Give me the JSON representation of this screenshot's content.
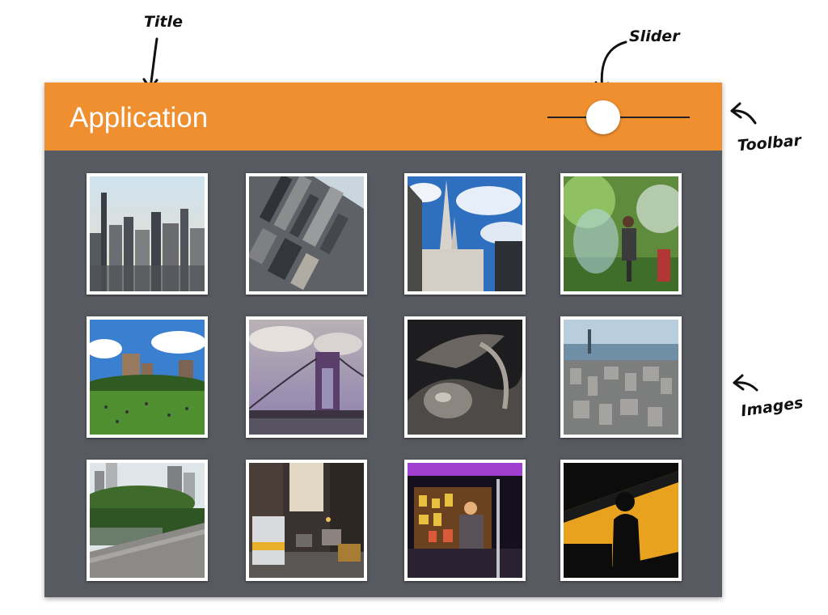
{
  "annotations": {
    "title": "Title",
    "slider": "Slider",
    "toolbar": "Toolbar",
    "images": "Images"
  },
  "toolbar": {
    "title": "Application",
    "background_color": "#ef8f30",
    "slider_value": 0.27
  },
  "content": {
    "background_color": "#575a60",
    "images": [
      {
        "subject": "midtown-skyline-sunny"
      },
      {
        "subject": "aerial-city-tilted"
      },
      {
        "subject": "cathedral-spires-blue-sky"
      },
      {
        "subject": "park-bubble-performer"
      },
      {
        "subject": "sheep-meadow-park"
      },
      {
        "subject": "bridge-tower-purple-sky"
      },
      {
        "subject": "bronze-statue-detail"
      },
      {
        "subject": "aerial-downtown-harbor"
      },
      {
        "subject": "park-pond-skyline"
      },
      {
        "subject": "street-traffic-buses"
      },
      {
        "subject": "food-cart-night"
      },
      {
        "subject": "silhouette-yellow-window"
      }
    ]
  }
}
